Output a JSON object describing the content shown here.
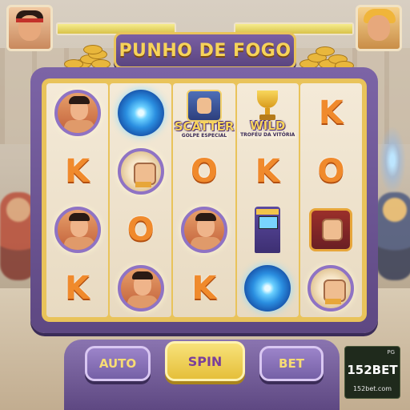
{
  "game": {
    "title": "PUNHO DE FOGO"
  },
  "hud": {
    "player_health": 1.0,
    "opponent_health": 1.0
  },
  "reels": [
    {
      "cells": [
        {
          "type": "fighter-badge",
          "icon": "fighter-icon"
        },
        {
          "type": "letter",
          "text": "K"
        },
        {
          "type": "fighter-badge",
          "icon": "fighter-icon"
        },
        {
          "type": "letter",
          "text": "K"
        }
      ]
    },
    {
      "cells": [
        {
          "type": "vortex",
          "icon": "vortex-icon"
        },
        {
          "type": "fist-badge",
          "icon": "fist-icon"
        },
        {
          "type": "letter",
          "text": "O"
        },
        {
          "type": "fighter-badge",
          "icon": "fighter-icon"
        }
      ]
    },
    {
      "cells": [
        {
          "type": "scatter",
          "icon": "fist-icon",
          "title": "SCATTER",
          "subtitle": "GOLPE ESPECIAL"
        },
        {
          "type": "letter",
          "text": "O"
        },
        {
          "type": "fighter-badge",
          "icon": "fighter-icon"
        },
        {
          "type": "letter",
          "text": "K"
        }
      ]
    },
    {
      "cells": [
        {
          "type": "wild",
          "icon": "trophy-icon",
          "title": "WILD",
          "subtitle": "TROFÉU DA VITÓRIA"
        },
        {
          "type": "letter",
          "text": "K"
        },
        {
          "type": "arcade",
          "icon": "arcade-cabinet-icon"
        },
        {
          "type": "vortex",
          "icon": "vortex-icon"
        }
      ]
    },
    {
      "cells": [
        {
          "type": "letter",
          "text": "K"
        },
        {
          "type": "letter",
          "text": "O"
        },
        {
          "type": "fist-square",
          "icon": "fist-icon"
        },
        {
          "type": "fist-badge",
          "icon": "fist-icon"
        }
      ]
    }
  ],
  "controls": {
    "auto_label": "AUTO",
    "spin_label": "SPIN",
    "bet_label": "BET"
  },
  "brand": {
    "provider": "PG",
    "name": "152BET",
    "url": "152bet.com"
  },
  "colors": {
    "frame_purple": "#6b549a",
    "gold": "#e9c35a",
    "letter_orange": "#f08a2c"
  }
}
